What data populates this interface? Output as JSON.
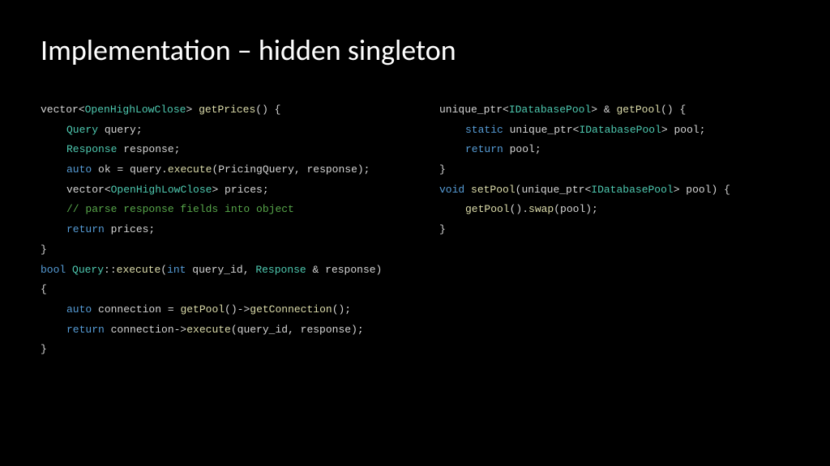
{
  "title": "Implementation – hidden singleton",
  "left": {
    "l1a": "vector",
    "l1b": "<",
    "l1c": "OpenHighLowClose",
    "l1d": "> ",
    "l1e": "getPrices",
    "l1f": "() {",
    "l2a": "Query",
    "l2b": " query;",
    "l3a": "Response",
    "l3b": " response;",
    "l4a": "auto",
    "l4b": " ok = query.",
    "l4c": "execute",
    "l4d": "(PricingQuery, response);",
    "l5a": "vector",
    "l5b": "<",
    "l5c": "OpenHighLowClose",
    "l5d": "> prices;",
    "l6a": "// parse response fields into object",
    "l7a": "return",
    "l7b": " prices;",
    "l8": "}",
    "l9a": "bool",
    "l9b": " ",
    "l9c": "Query",
    "l9d": "::",
    "l9e": "execute",
    "l9f": "(",
    "l9g": "int",
    "l9h": " query_id, ",
    "l9i": "Response",
    "l9j": " & response)",
    "l10": "{",
    "l11a": "auto",
    "l11b": " connection = ",
    "l11c": "getPool",
    "l11d": "()->",
    "l11e": "getConnection",
    "l11f": "();",
    "l12a": "return",
    "l12b": " connection->",
    "l12c": "execute",
    "l12d": "(query_id, response);",
    "l13": "}"
  },
  "right": {
    "r1a": "unique_ptr",
    "r1b": "<",
    "r1c": "IDatabasePool",
    "r1d": "> & ",
    "r1e": "getPool",
    "r1f": "() {",
    "r2a": "static",
    "r2b": " ",
    "r2c": "unique_ptr",
    "r2d": "<",
    "r2e": "IDatabasePool",
    "r2f": "> pool;",
    "r3a": "return",
    "r3b": " pool;",
    "r4": "}",
    "r5a": "void",
    "r5b": " ",
    "r5c": "setPool",
    "r5d": "(",
    "r5e": "unique_ptr",
    "r5f": "<",
    "r5g": "IDatabasePool",
    "r5h": "> pool) {",
    "r6a": "getPool",
    "r6b": "().",
    "r6c": "swap",
    "r6d": "(pool);",
    "r7": "}"
  }
}
